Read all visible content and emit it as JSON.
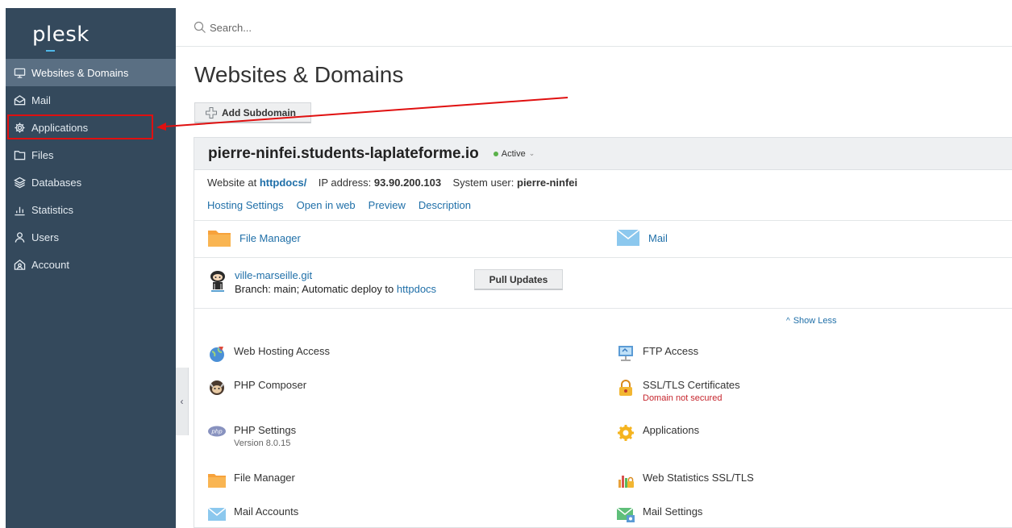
{
  "app": {
    "logo": "plesk"
  },
  "sidebar": {
    "items": [
      {
        "label": "Websites & Domains",
        "icon": "monitor-icon",
        "active": true
      },
      {
        "label": "Mail",
        "icon": "mail-icon",
        "active": false
      },
      {
        "label": "Applications",
        "icon": "gear-icon",
        "active": false
      },
      {
        "label": "Files",
        "icon": "folder-icon",
        "active": false
      },
      {
        "label": "Databases",
        "icon": "database-icon",
        "active": false
      },
      {
        "label": "Statistics",
        "icon": "bar-chart-icon",
        "active": false
      },
      {
        "label": "Users",
        "icon": "user-icon",
        "active": false
      },
      {
        "label": "Account",
        "icon": "account-icon",
        "active": false
      }
    ],
    "collapse_glyph": "‹"
  },
  "search": {
    "placeholder": "Search..."
  },
  "main": {
    "title": "Websites & Domains",
    "add_subdomain_label": "Add Subdomain"
  },
  "domain": {
    "name": "pierre-ninfei.students-laplateforme.io",
    "status": "Active",
    "status_chevron": "⌄",
    "status_color": "#5ab14a",
    "website_at_label": "Website at",
    "website_path": "httpdocs/",
    "ip_label": "IP address:",
    "ip": "93.90.200.103",
    "system_user_label": "System user:",
    "system_user": "pierre-ninfei",
    "links": [
      "Hosting Settings",
      "Open in web",
      "Preview",
      "Description"
    ]
  },
  "quick_tools": {
    "file_manager": "File Manager",
    "mail": "Mail"
  },
  "git": {
    "repo": "ville-marseille.git",
    "branch_text": "Branch: main; Automatic deploy to",
    "deploy_target": "httpdocs",
    "pull_button": "Pull Updates"
  },
  "show_less": "Show Less",
  "show_less_glyph": "^",
  "tools": {
    "left": [
      {
        "label": "Web Hosting Access",
        "sub": "",
        "icon": "web-hosting-globe-icon"
      },
      {
        "label": "PHP Composer",
        "sub": "",
        "icon": "php-composer-icon"
      },
      {
        "label": "PHP Settings",
        "sub": "Version 8.0.15",
        "icon": "php-icon"
      },
      {
        "label": "File Manager",
        "sub": "",
        "icon": "folder-icon"
      },
      {
        "label": "Mail Accounts",
        "sub": "",
        "icon": "envelope-icon"
      }
    ],
    "right": [
      {
        "label": "FTP Access",
        "sub": "",
        "icon": "ftp-monitor-icon"
      },
      {
        "label": "SSL/TLS Certificates",
        "sub": "Domain not secured",
        "icon": "padlock-icon"
      },
      {
        "label": "Applications",
        "sub": "",
        "icon": "gear-icon"
      },
      {
        "label": "Web Statistics SSL/TLS",
        "sub": "",
        "icon": "stats-lock-icon"
      },
      {
        "label": "Mail Settings",
        "sub": "",
        "icon": "mail-settings-icon"
      }
    ]
  },
  "colors": {
    "sidebar_bg": "#34495c",
    "link": "#1f6fa8",
    "annotation": "#e01010",
    "warning": "#c6262e"
  }
}
